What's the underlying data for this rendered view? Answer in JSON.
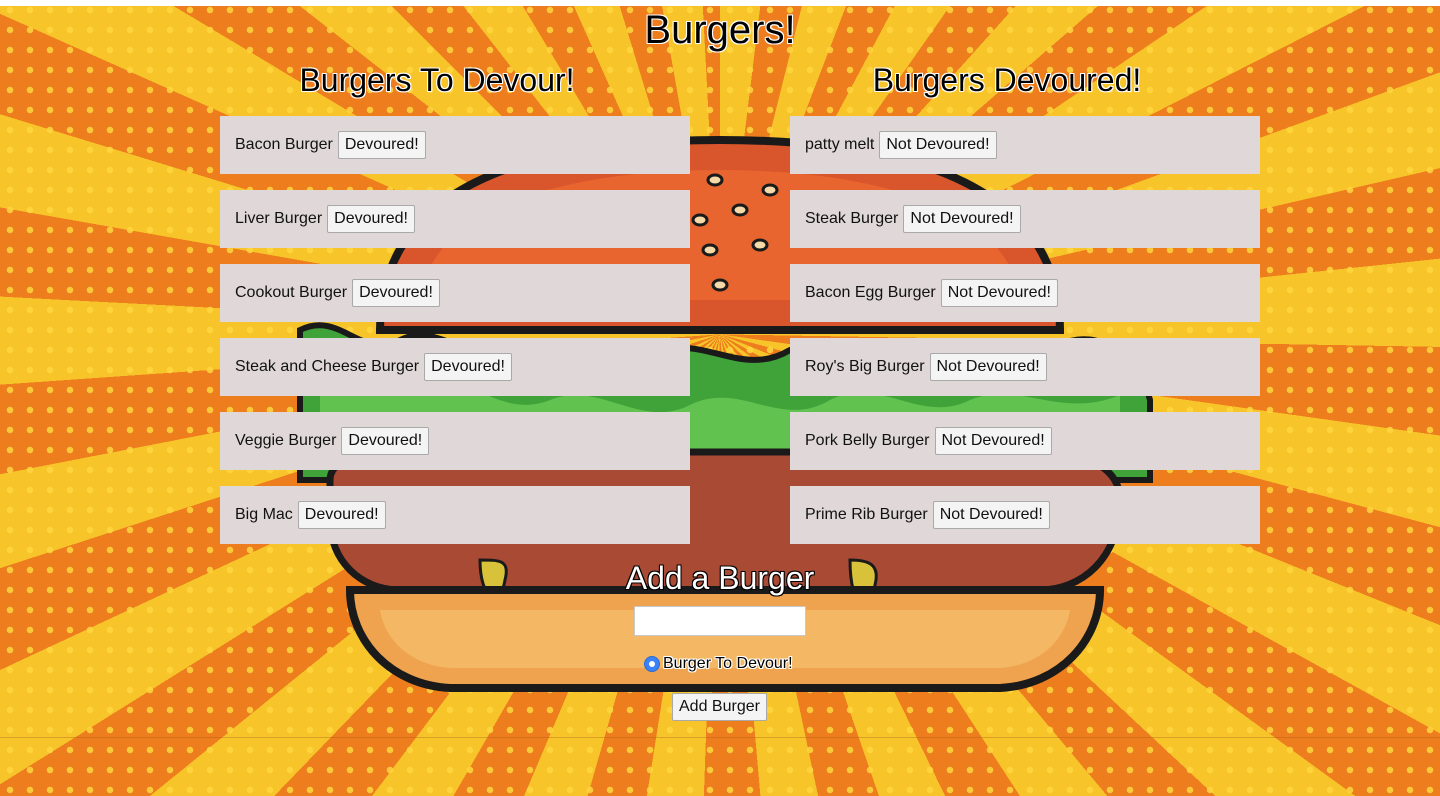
{
  "page_title": "Burgers!",
  "to_devour": {
    "title": "Burgers To Devour!",
    "button_label": "Devoured!",
    "items": [
      {
        "name": "Bacon Burger"
      },
      {
        "name": "Liver Burger"
      },
      {
        "name": "Cookout Burger"
      },
      {
        "name": "Steak and Cheese Burger"
      },
      {
        "name": "Veggie Burger"
      },
      {
        "name": "Big Mac"
      }
    ]
  },
  "devoured": {
    "title": "Burgers Devoured!",
    "button_label": "Not Devoured!",
    "items": [
      {
        "name": "patty melt"
      },
      {
        "name": "Steak Burger"
      },
      {
        "name": "Bacon Egg Burger"
      },
      {
        "name": "Roy's Big Burger"
      },
      {
        "name": "Pork Belly Burger"
      },
      {
        "name": "Prime Rib Burger"
      }
    ]
  },
  "add_form": {
    "title": "Add a Burger",
    "input_value": "",
    "radio_label": "Burger To Devour!",
    "radio_checked": true,
    "submit_label": "Add Burger"
  },
  "colors": {
    "background_orange": "#ee7d1e",
    "background_yellow": "#f7c52a",
    "list_item_bg": "#e0d8d8",
    "radio_accent": "#3b82f6"
  }
}
